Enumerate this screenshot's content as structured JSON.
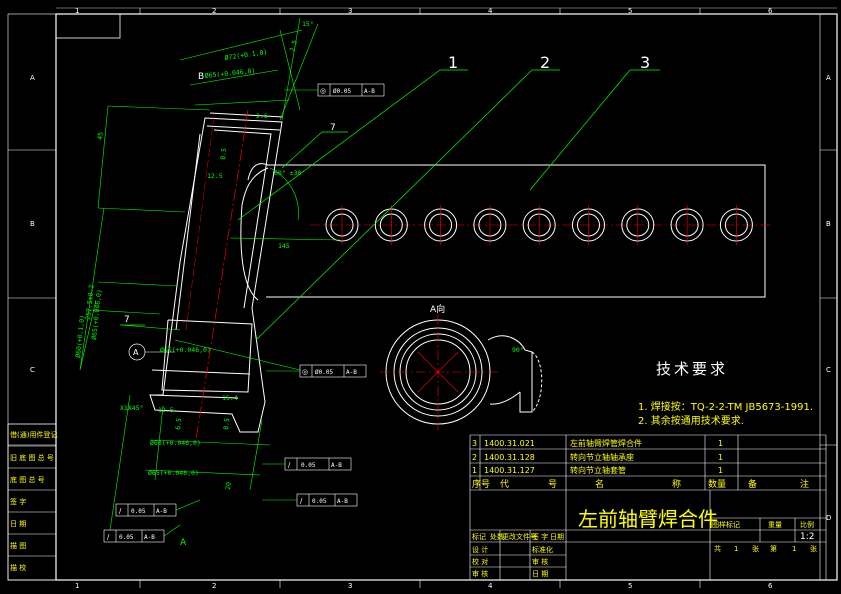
{
  "zone_columns": [
    "1",
    "2",
    "3",
    "4",
    "5",
    "6"
  ],
  "zone_rows": [
    "A",
    "B",
    "C",
    "D"
  ],
  "view_labels": {
    "section_b": "B",
    "view_a_marker": "A",
    "view_a_title": "A向",
    "view_a_arrow": "A",
    "circle_a": "A"
  },
  "balloons": [
    "1",
    "2",
    "3",
    "7",
    "7"
  ],
  "dimensions": {
    "d1": "15°",
    "d2": "Ø72(+0.1,0)",
    "d3": "Ø65(+0.046,0)",
    "d4": "2.5",
    "d5": "2.6",
    "d6": "45",
    "d7": "12.5",
    "d8": "8.5",
    "d9": "60° ±30'",
    "d10": "145",
    "d11": "257.5±0.2",
    "d12": "Ø60(+0.1,0)",
    "d13": "Ø65(+0.046,0)",
    "d14": "Ø65(+0.046,0)",
    "d15": "X1X45°",
    "d16": "12.5",
    "d17": "15.4",
    "d18": "Ø60(+0.046,0)",
    "d19": "Ø65(+0.046,0)",
    "d20": "20",
    "d21": "8.5",
    "d22": "90°",
    "d23": "6.5"
  },
  "tolerance_frames": [
    {
      "sym": "◎",
      "val": "Ø0.05",
      "ref": "A-B"
    },
    {
      "sym": "◎",
      "val": "Ø0.05",
      "ref": "A-B"
    },
    {
      "sym": "/",
      "val": "0.05",
      "ref": "A-B"
    },
    {
      "sym": "/",
      "val": "0.05",
      "ref": "A-B"
    },
    {
      "sym": "/",
      "val": "0.05",
      "ref": "A-B"
    },
    {
      "sym": "/",
      "val": "0.05",
      "ref": "A-B"
    }
  ],
  "tech_requirements": {
    "title": "技术要求",
    "items": [
      "1. 焊接按：TQ-2-2-TM JB5673-1991.",
      "2. 其余按通用技术要求."
    ]
  },
  "bom": {
    "rows": [
      {
        "no": "3",
        "code": "1400.31.021",
        "name": "左前轴臂焊管焊合件",
        "qty": "1"
      },
      {
        "no": "2",
        "code": "1400.31.128",
        "name": "转向节立轴轴承座",
        "qty": "1"
      },
      {
        "no": "1",
        "code": "1400.31.127",
        "name": "转向节立轴套管",
        "qty": "1"
      }
    ],
    "headers": [
      "序号",
      "代",
      "号",
      "名",
      "称",
      "数量",
      "备",
      "注"
    ]
  },
  "title_block": {
    "drawing_title": "左前轴臂焊合件",
    "scale_label_row": [
      "图样标记",
      "重量",
      "比例"
    ],
    "scale": "1:2",
    "sheet_row": [
      "共",
      "1",
      "张",
      "第",
      "1",
      "张"
    ],
    "rev_row": [
      "标记",
      "处数",
      "更改文件号",
      "签 字",
      "日期"
    ],
    "people": [
      [
        "设 计",
        "标准化"
      ],
      [
        "校 对",
        "审 核"
      ],
      [
        "审 核",
        "日 期"
      ]
    ]
  },
  "left_strip": [
    "借(通)用件登记",
    "旧 底 图 总 号",
    "底 图 总 号",
    "签 字",
    "日 期",
    "描 图",
    "描 校"
  ]
}
